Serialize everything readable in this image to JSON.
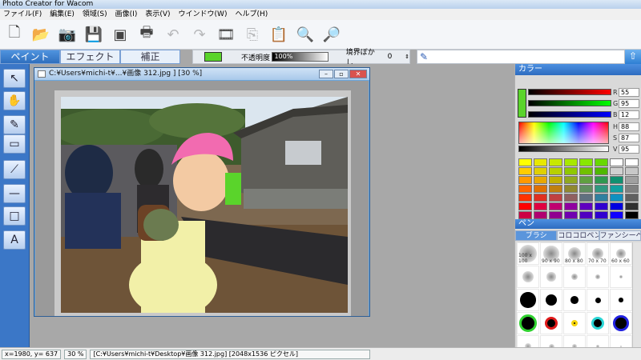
{
  "app": {
    "title": "Photo Creator for Wacom"
  },
  "menu": [
    "ファイル(F)",
    "編集(E)",
    "領域(S)",
    "画像(I)",
    "表示(V)",
    "ウインドウ(W)",
    "ヘルプ(H)"
  ],
  "toolbar": {
    "buttons": [
      {
        "name": "new-icon",
        "glyph": "🗋",
        "enabled": true
      },
      {
        "name": "open-icon",
        "glyph": "📂",
        "enabled": true
      },
      {
        "name": "camera-icon",
        "glyph": "📷",
        "enabled": true
      },
      {
        "name": "save-icon",
        "glyph": "💾",
        "enabled": true
      },
      {
        "name": "export-icon",
        "glyph": "▣",
        "enabled": true
      },
      {
        "name": "print-icon",
        "glyph": "🖶",
        "enabled": true
      },
      {
        "name": "undo-icon",
        "glyph": "↶",
        "enabled": false
      },
      {
        "name": "redo-icon",
        "glyph": "↷",
        "enabled": false
      },
      {
        "name": "film-icon",
        "glyph": "🎞",
        "enabled": true
      },
      {
        "name": "copy-icon",
        "glyph": "⎘",
        "enabled": false
      },
      {
        "name": "paste-icon",
        "glyph": "📋",
        "enabled": true
      },
      {
        "name": "zoom-in-icon",
        "glyph": "🔍",
        "enabled": true
      },
      {
        "name": "zoom-out-icon",
        "glyph": "🔎",
        "enabled": true
      }
    ]
  },
  "tabs": [
    "ペイント",
    "エフェクト",
    "補正"
  ],
  "options": {
    "opacity_label": "不透明度",
    "opacity_value": "100%",
    "blur_label": "境界ぼかし",
    "blur_value": "0"
  },
  "document": {
    "title": "C:¥Users¥michi-t¥...¥画像 312.jpg ] [30 %]"
  },
  "tools": [
    {
      "name": "select-arrow-icon",
      "glyph": "↖"
    },
    {
      "name": "hand-icon",
      "glyph": "✋"
    },
    {
      "name": "pen-icon",
      "glyph": "✎"
    },
    {
      "name": "eraser-icon",
      "glyph": "▭"
    },
    {
      "name": "dropper-icon",
      "glyph": "⟋"
    },
    {
      "name": "line-icon",
      "glyph": "—"
    },
    {
      "name": "rect-icon",
      "glyph": "□"
    },
    {
      "name": "text-icon",
      "glyph": "A"
    }
  ],
  "color_panel": {
    "title": "カラー",
    "rgb": [
      {
        "label": "R",
        "value": "55"
      },
      {
        "label": "G",
        "value": "95"
      },
      {
        "label": "B",
        "value": "12"
      }
    ],
    "hsv": [
      {
        "label": "H",
        "value": "88"
      },
      {
        "label": "S",
        "value": "87"
      },
      {
        "label": "V",
        "value": "95"
      }
    ],
    "current_color": "#5ad42b"
  },
  "pen_panel": {
    "title": "ペン",
    "tabs": [
      "ブラシ",
      "コロコロペン",
      "ファンシーペン"
    ],
    "brush_sizes": [
      "100 x 100",
      "90 x 90",
      "80 x 80",
      "70 x 70",
      "60 x 60"
    ]
  },
  "status": {
    "coords": "x=1980, y= 637",
    "zoom": "30 %",
    "path": "[C:¥Users¥michi-t¥Desktop¥画像 312.jpg] [2048x1536 ピクセル]"
  }
}
